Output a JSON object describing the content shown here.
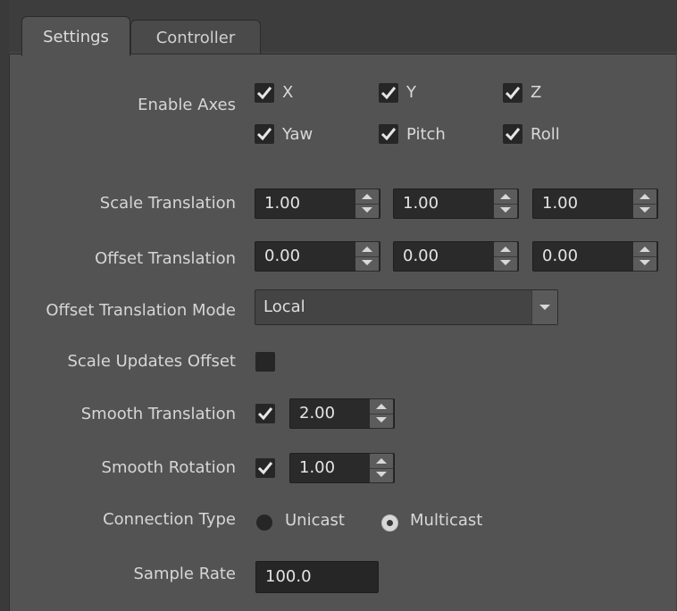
{
  "tabs": [
    {
      "label": "Settings",
      "active": true
    },
    {
      "label": "Controller",
      "active": false
    }
  ],
  "enable_axes": {
    "label": "Enable Axes",
    "options": [
      {
        "label": "X",
        "checked": true
      },
      {
        "label": "Y",
        "checked": true
      },
      {
        "label": "Z",
        "checked": true
      },
      {
        "label": "Yaw",
        "checked": true
      },
      {
        "label": "Pitch",
        "checked": true
      },
      {
        "label": "Roll",
        "checked": true
      }
    ]
  },
  "scale_translation": {
    "label": "Scale Translation",
    "values": [
      "1.00",
      "1.00",
      "1.00"
    ]
  },
  "offset_translation": {
    "label": "Offset Translation",
    "values": [
      "0.00",
      "0.00",
      "0.00"
    ]
  },
  "offset_translation_mode": {
    "label": "Offset Translation Mode",
    "value": "Local"
  },
  "scale_updates_offset": {
    "label": "Scale Updates Offset",
    "checked": false
  },
  "smooth_translation": {
    "label": "Smooth Translation",
    "checked": true,
    "value": "2.00"
  },
  "smooth_rotation": {
    "label": "Smooth Rotation",
    "checked": true,
    "value": "1.00"
  },
  "connection_type": {
    "label": "Connection Type",
    "options": [
      {
        "label": "Unicast",
        "selected": false
      },
      {
        "label": "Multicast",
        "selected": true
      }
    ]
  },
  "sample_rate": {
    "label": "Sample Rate",
    "value": "100.0"
  },
  "colors": {
    "panel": "#535353",
    "field": "#262626",
    "text": "#d6d6d6"
  }
}
